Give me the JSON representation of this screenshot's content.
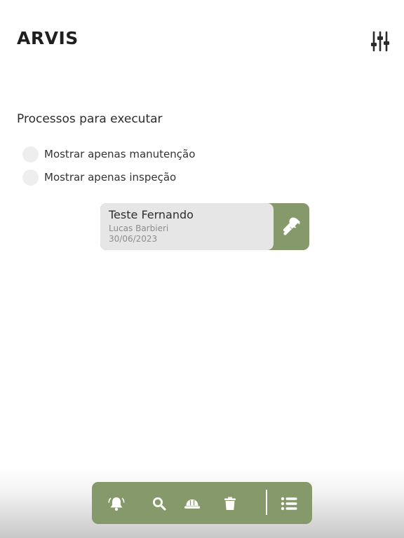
{
  "header": {
    "title": "ARVIS",
    "filter_icon": "sliders-icon"
  },
  "section": {
    "title": "Processos para executar"
  },
  "filters": [
    {
      "label": "Mostrar apenas manutenção",
      "checked": false
    },
    {
      "label": "Mostrar apenas inspeção",
      "checked": false
    }
  ],
  "processes": [
    {
      "title": "Teste Fernando",
      "author": "Lucas Barbieri",
      "date": "30/06/2023",
      "type_icon": "tools-icon"
    }
  ],
  "bottom_nav": {
    "items": [
      "bell-icon",
      "search-icon",
      "hard-hat-icon",
      "trash-icon",
      "list-icon"
    ]
  },
  "colors": {
    "accent": "#86996a",
    "card_bg": "#e6e6e6",
    "radio_bg": "#eeeeee",
    "text": "#2e2e2e",
    "muted": "#8c8c8c"
  }
}
